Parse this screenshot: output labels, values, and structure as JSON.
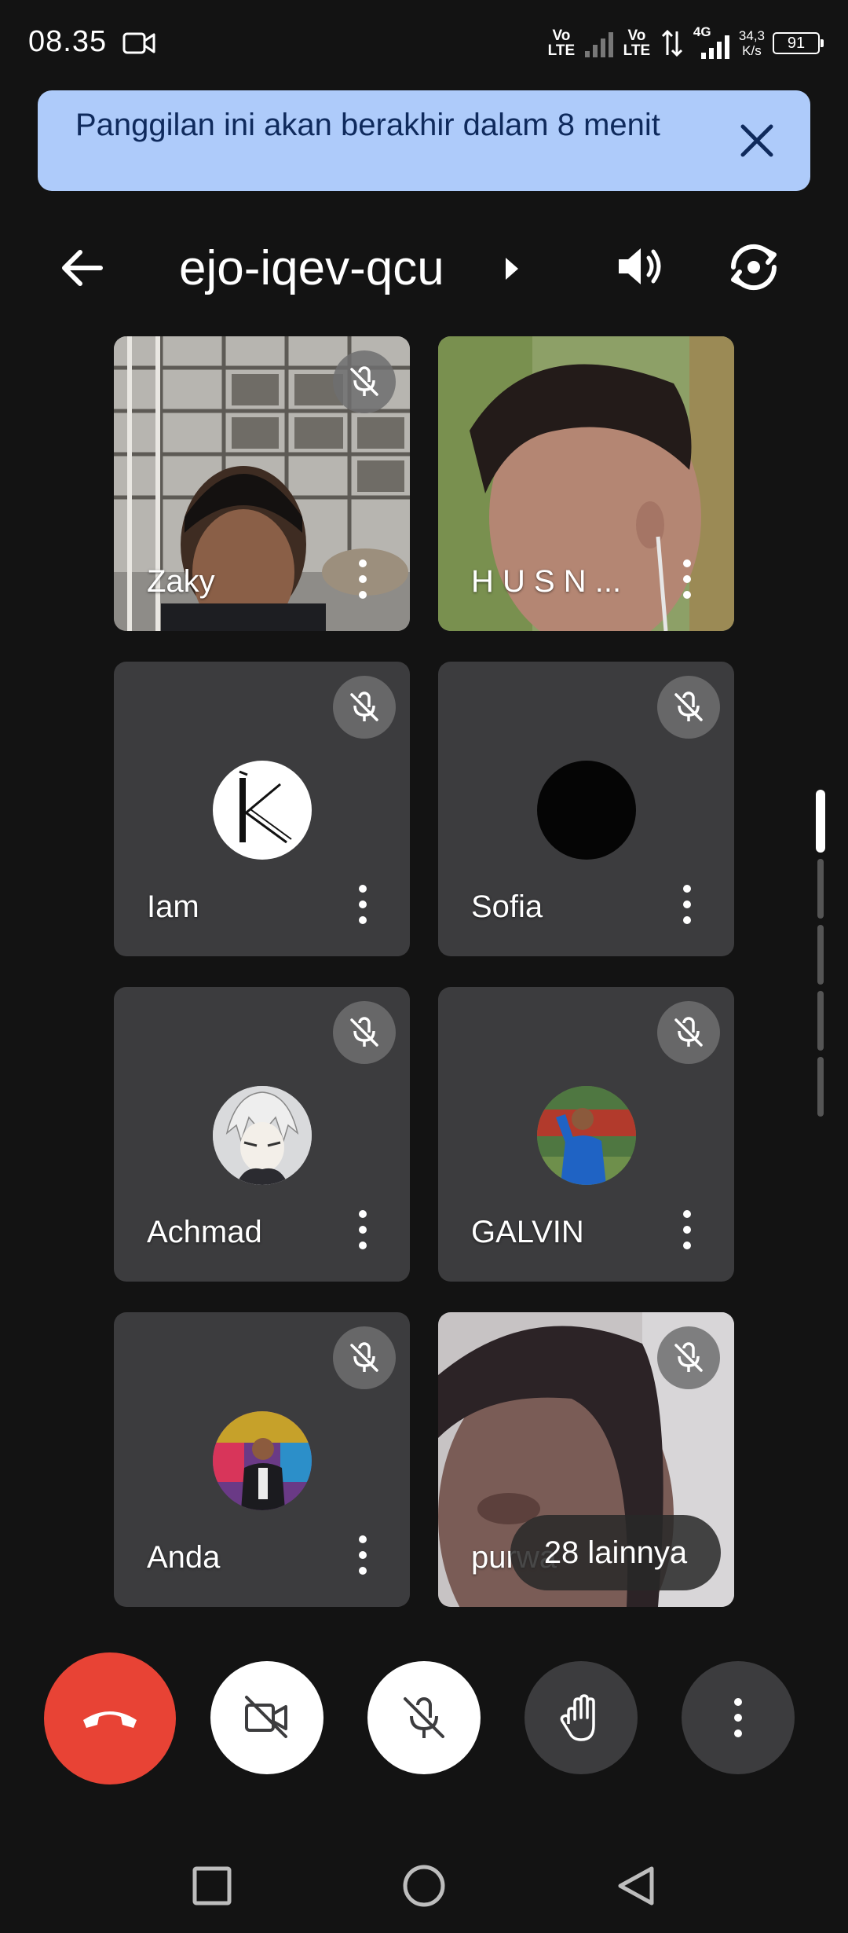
{
  "status_bar": {
    "time": "08.35",
    "network_1": "Vo LTE",
    "network_2": "Vo LTE",
    "network_type": "4G",
    "speed_value": "34,3",
    "speed_unit": "K/s",
    "battery": "91"
  },
  "banner": {
    "message": "Panggilan ini akan berakhir dalam 8 menit",
    "background": "#aecbfa",
    "text_color": "#0f2a5c"
  },
  "header": {
    "meeting_code": "ejo-iqev-qcu"
  },
  "participants": [
    {
      "name": "Zaky",
      "video": true,
      "muted": true
    },
    {
      "name": "H U S N ...",
      "video": true,
      "muted": false
    },
    {
      "name": "Iam",
      "video": false,
      "muted": true,
      "avatar": "k-logo-avatar"
    },
    {
      "name": "Sofia",
      "video": false,
      "muted": true,
      "avatar": "black-circle-avatar"
    },
    {
      "name": "Achmad",
      "video": false,
      "muted": true,
      "avatar": "anime-avatar"
    },
    {
      "name": "GALVIN",
      "video": false,
      "muted": true,
      "avatar": "photo-avatar"
    },
    {
      "name": "Anda",
      "video": false,
      "muted": true,
      "avatar": "photo-avatar"
    },
    {
      "name": "purwa",
      "video": true,
      "muted": true
    }
  ],
  "overflow": {
    "label": "28 lainnya"
  },
  "controls": {
    "end_call_color": "#e84335",
    "icons": [
      "phone-hangup-icon",
      "camera-off-icon",
      "mic-off-icon",
      "raise-hand-icon",
      "more-vert-icon"
    ]
  },
  "nav": {
    "icons": [
      "recent-apps-icon",
      "home-icon",
      "back-icon"
    ]
  }
}
